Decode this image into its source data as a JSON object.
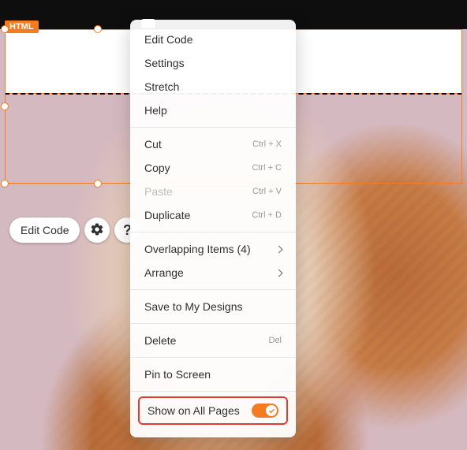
{
  "badge": {
    "label": "HTML"
  },
  "toolbar": {
    "edit_code_label": "Edit Code",
    "help_glyph": "?"
  },
  "context_menu": {
    "edit_code": "Edit Code",
    "settings": "Settings",
    "stretch": "Stretch",
    "help": "Help",
    "cut": {
      "label": "Cut",
      "shortcut": "Ctrl + X"
    },
    "copy": {
      "label": "Copy",
      "shortcut": "Ctrl + C"
    },
    "paste": {
      "label": "Paste",
      "shortcut": "Ctrl + V"
    },
    "duplicate": {
      "label": "Duplicate",
      "shortcut": "Ctrl + D"
    },
    "overlapping": {
      "label": "Overlapping Items (4)"
    },
    "arrange": {
      "label": "Arrange"
    },
    "save_to_designs": "Save to My Designs",
    "delete": {
      "label": "Delete",
      "shortcut": "Del"
    },
    "pin": "Pin to Screen",
    "show_all_pages": {
      "label": "Show on All Pages",
      "state": "on"
    }
  },
  "colors": {
    "accent": "#f47b20",
    "highlight_border": "#e33b2e"
  }
}
